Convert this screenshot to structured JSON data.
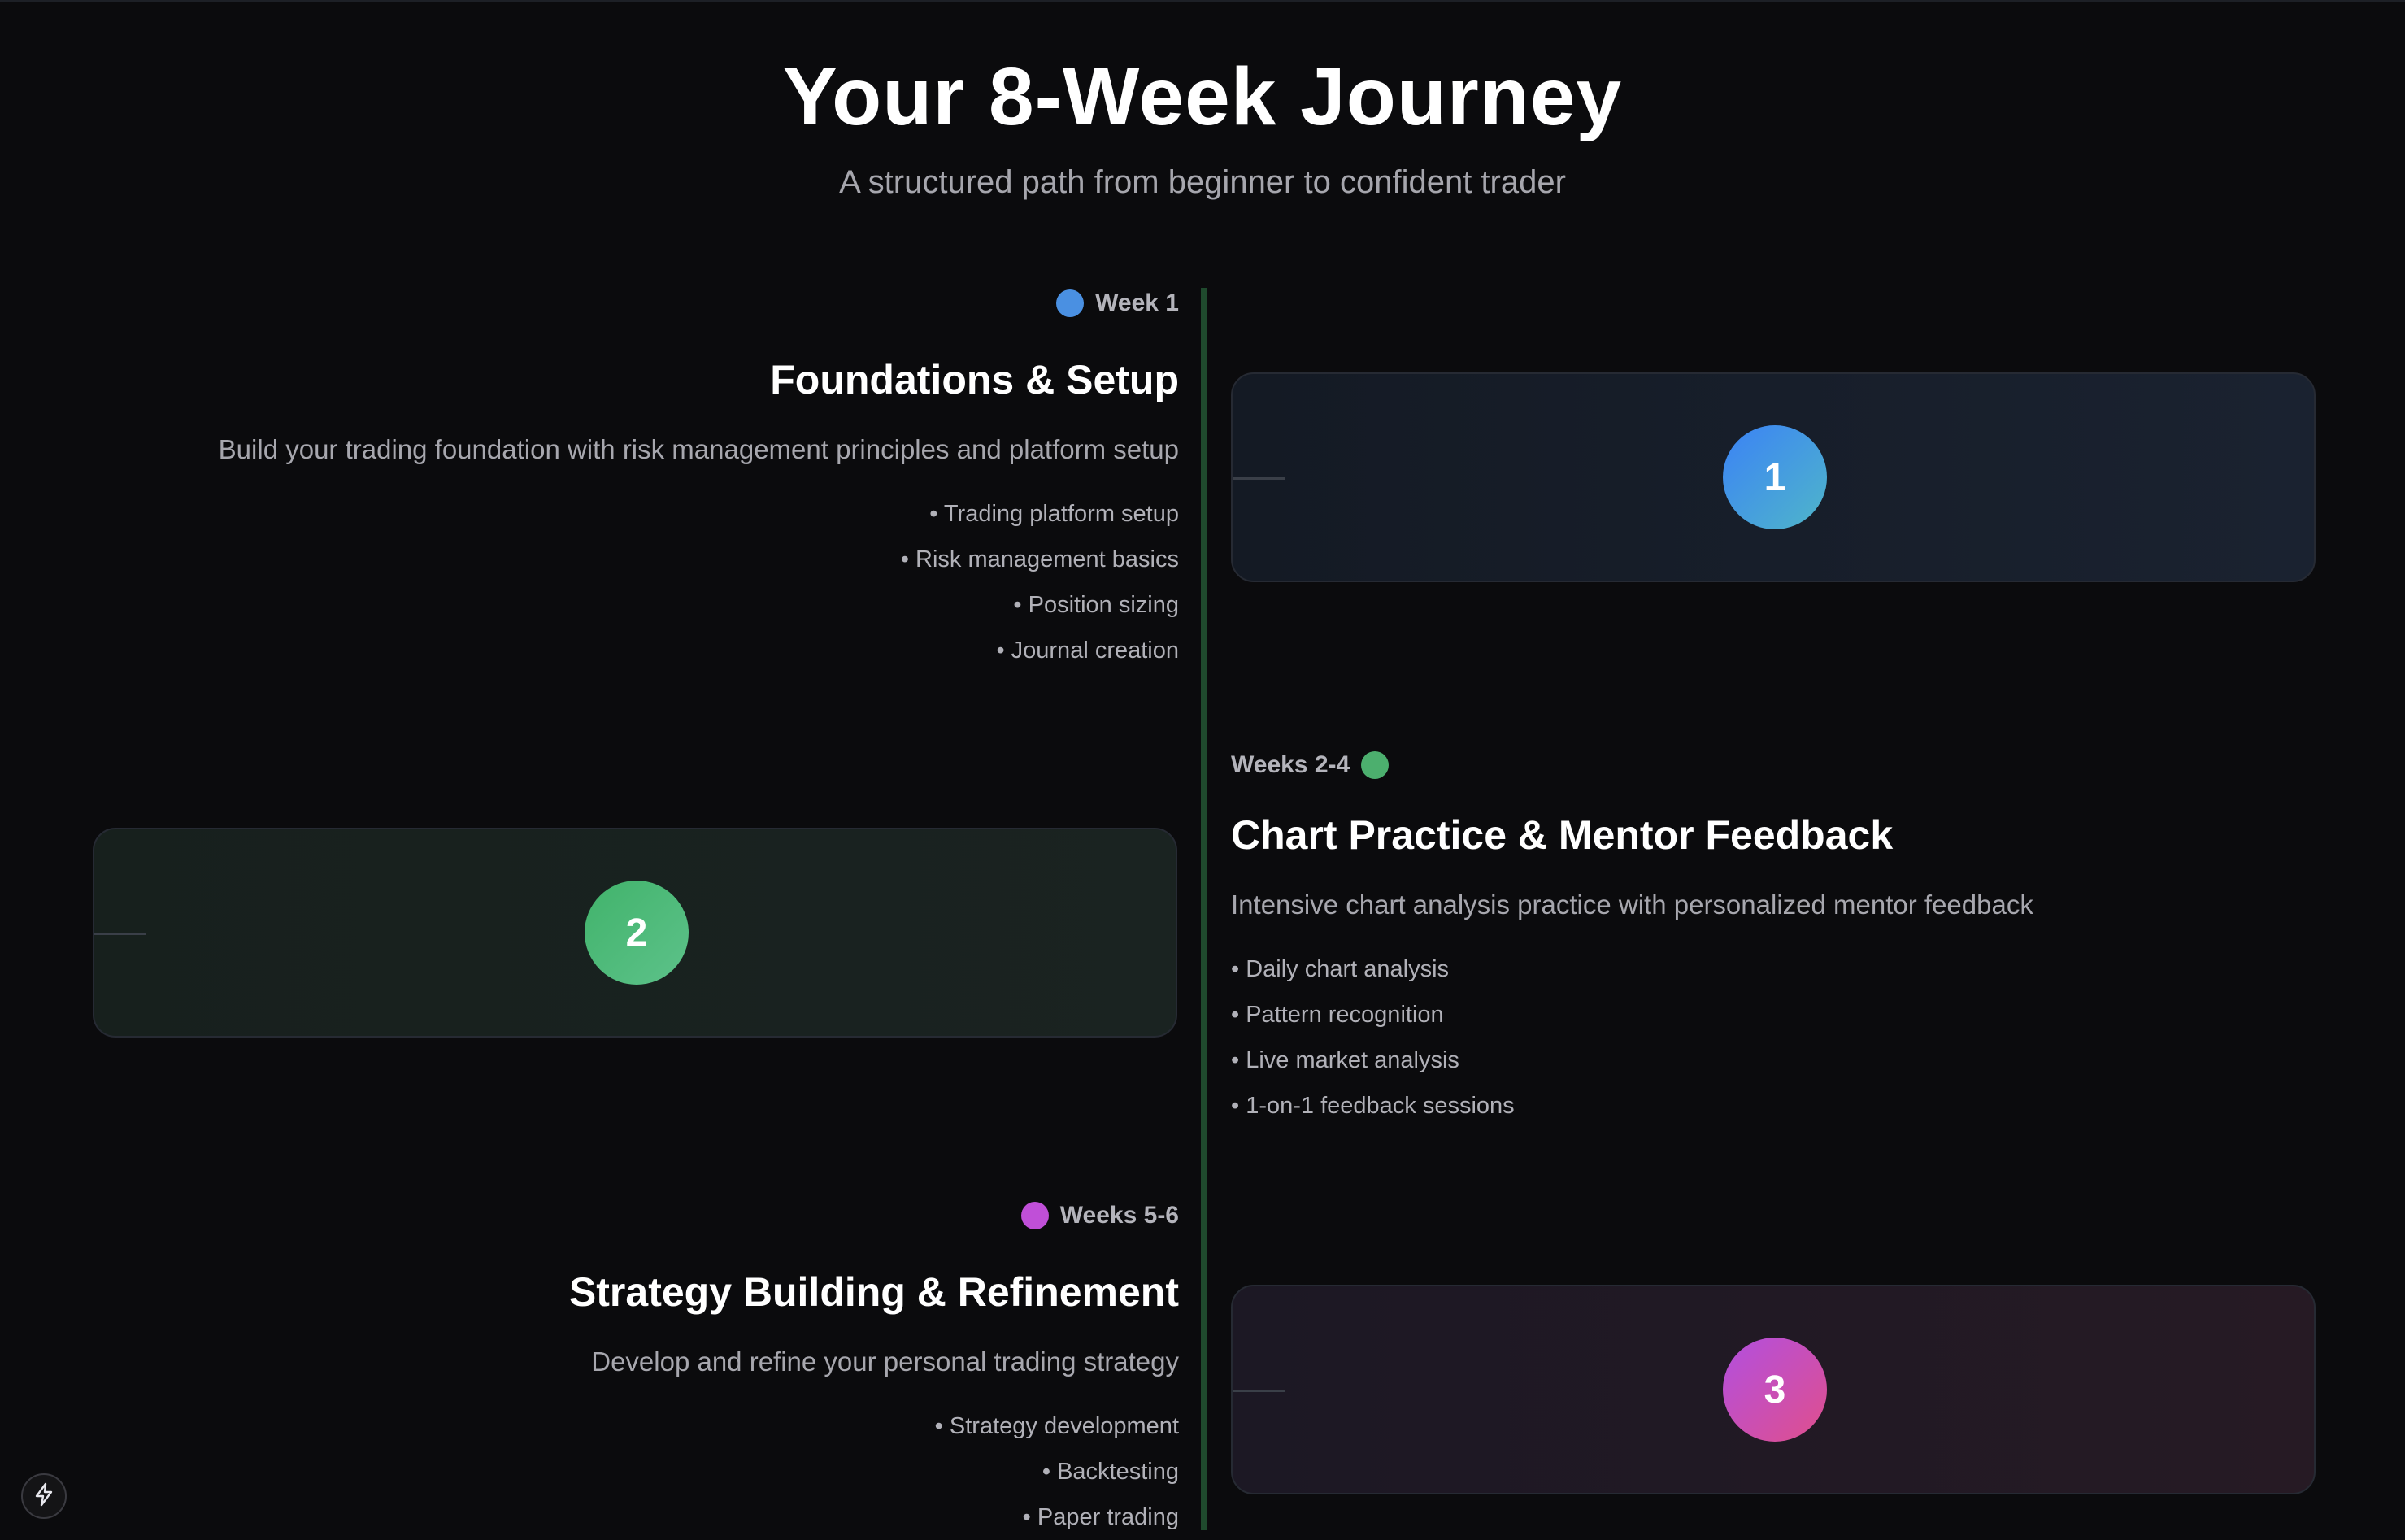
{
  "header": {
    "title": "Your 8-Week Journey",
    "subtitle": "A structured path from beginner to confident trader"
  },
  "phases": [
    {
      "tag": "Week 1",
      "title": "Foundations & Setup",
      "description": "Build your trading foundation with risk management principles and platform setup",
      "bullets": [
        "• Trading platform setup",
        "• Risk management basics",
        "• Position sizing",
        "• Journal creation"
      ],
      "number": "1",
      "dot_color": "#4a90e2",
      "gradient": [
        "#3b82f6",
        "#4fb6c9"
      ],
      "card_tint": [
        "#141a24",
        "#1a2230"
      ]
    },
    {
      "tag": "Weeks 2-4",
      "title": "Chart Practice & Mentor Feedback",
      "description": "Intensive chart analysis practice with personalized mentor feedback",
      "bullets": [
        "• Daily chart analysis",
        "• Pattern recognition",
        "• Live market analysis",
        "• 1-on-1 feedback sessions"
      ],
      "number": "2",
      "dot_color": "#4caf6e",
      "gradient": [
        "#41b36b",
        "#5dc28a"
      ],
      "card_tint": [
        "#17201d",
        "#1a2321"
      ]
    },
    {
      "tag": "Weeks 5-6",
      "title": "Strategy Building & Refinement",
      "description": "Develop and refine your personal trading strategy",
      "bullets": [
        "• Strategy development",
        "• Backtesting",
        "• Paper trading"
      ],
      "number": "3",
      "dot_color": "#c04fd8",
      "gradient": [
        "#b24fe0",
        "#e04f8c"
      ],
      "card_tint": [
        "#1c1824",
        "#261a24"
      ]
    }
  ],
  "fab": {
    "icon": "lightning-bolt-icon"
  }
}
